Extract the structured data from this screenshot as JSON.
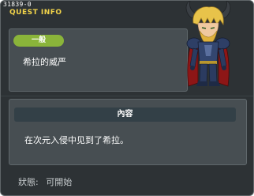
{
  "quest_id": "31839-0",
  "window_title": "QUEST INFO",
  "category_badge": "一般",
  "quest_name": "希拉的威严",
  "content_header": "內容",
  "content_text": "在次元入侵中见到了希拉。",
  "status": {
    "label": "狀態:",
    "value": "可開始"
  },
  "portrait": "horned-armored-warrior-portrait",
  "colors": {
    "window_bg": "#2d3235",
    "panel_bg": "#474e52",
    "badge_green": "#8ab43a",
    "title_yellow": "#f2d44a",
    "header_bar": "#334047"
  }
}
